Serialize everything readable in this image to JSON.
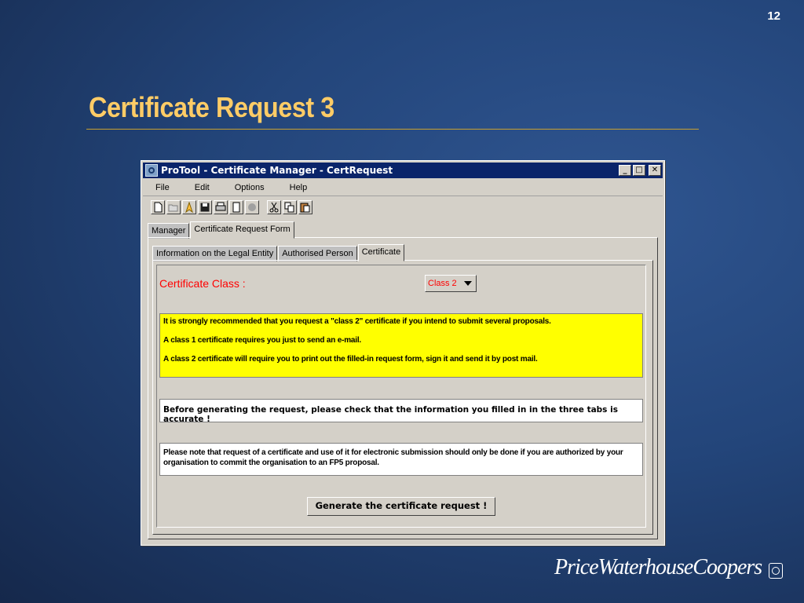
{
  "slide": {
    "page_number": "12",
    "title": "Certificate Request 3",
    "brand": "PriceWaterhouseCoopers"
  },
  "window": {
    "title": "ProTool - Certificate Manager - CertRequest",
    "controls": {
      "minimize": "_",
      "maximize": "□",
      "close": "✕"
    }
  },
  "menu": {
    "items": [
      {
        "label": "File"
      },
      {
        "label": "Edit"
      },
      {
        "label": "Options"
      },
      {
        "label": "Help"
      }
    ]
  },
  "toolbar": {
    "icons": [
      "new-document-icon",
      "open-folder-icon",
      "bookmark-icon",
      "save-icon",
      "print-icon",
      "scroll-icon",
      "disabled-circle-icon",
      "cut-icon",
      "copy-icon",
      "paste-icon"
    ]
  },
  "tabs_outer": [
    {
      "label": "Manager",
      "active": false
    },
    {
      "label": "Certificate Request Form",
      "active": true
    }
  ],
  "tabs_inner": [
    {
      "label": "Information on the Legal Entity",
      "active": false
    },
    {
      "label": "Authorised Person",
      "active": false
    },
    {
      "label": "Certificate",
      "active": true
    }
  ],
  "form": {
    "class_label": "Certificate Class :",
    "class_value": "Class 2",
    "recommendation": [
      "It is strongly recommended that you request a \"class 2\" certificate if you intend to submit several proposals.",
      "A class 1 certificate requires you just to send an e-mail.",
      "A class 2 certificate will require you to print out the filled-in request form, sign it and send it by post mail."
    ],
    "check_note": "Before generating the request, please check that the information you filled in in the three tabs is accurate !",
    "legal_note": "Please note that request of a certificate and use of it for electronic submission should only be done if you are authorized by your organisation to commit the organisation to an FP5 proposal.",
    "generate_label": "Generate the certificate request !"
  },
  "colors": {
    "title_bar": "#0a246a",
    "slide_title": "#ffcc66",
    "warning_bg": "#ffff00",
    "accent_red": "#ff0000"
  }
}
